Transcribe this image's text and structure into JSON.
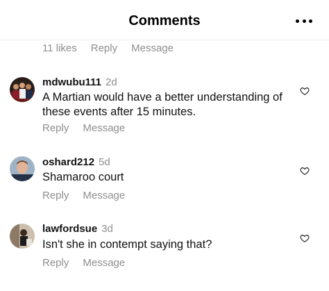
{
  "header": {
    "title": "Comments",
    "more_icon": "more-horizontal-icon"
  },
  "top_meta": {
    "likes": "11 likes",
    "reply": "Reply",
    "message": "Message"
  },
  "comments": [
    {
      "username": "mdwubu111",
      "time": "2d",
      "text": "A Martian would have a better understanding of these events after 15 minutes.",
      "reply": "Reply",
      "message": "Message",
      "like_icon": "heart-icon"
    },
    {
      "username": "oshard212",
      "time": "5d",
      "text": "Shamaroo court",
      "reply": "Reply",
      "message": "Message",
      "like_icon": "heart-icon"
    },
    {
      "username": "lawfordsue",
      "time": "3d",
      "text": "Isn't she in contempt saying that?",
      "reply": "Reply",
      "message": "Message",
      "like_icon": "heart-icon"
    }
  ],
  "colors": {
    "text": "#111111",
    "muted": "#8e8e8e",
    "divider": "#ececec"
  }
}
